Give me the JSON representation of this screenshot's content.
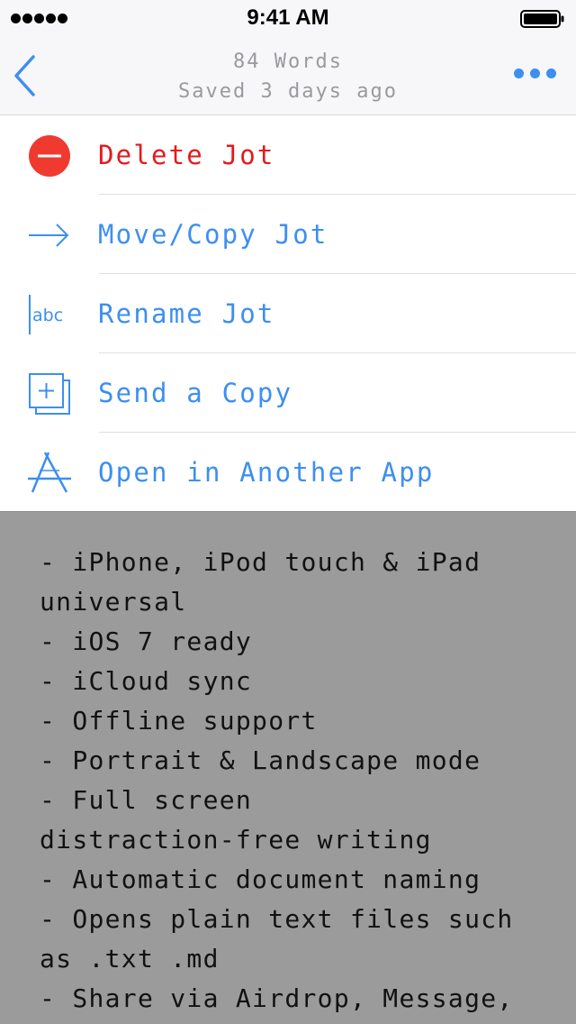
{
  "status_bar": {
    "time": "9:41 AM"
  },
  "nav": {
    "word_count": "84 Words",
    "saved": "Saved 3 days ago"
  },
  "menu": {
    "items": [
      {
        "label": "Delete Jot",
        "icon": "delete-icon"
      },
      {
        "label": "Move/Copy Jot",
        "icon": "arrow-right-icon"
      },
      {
        "label": "Rename Jot",
        "icon": "rename-icon"
      },
      {
        "label": "Send a Copy",
        "icon": "copy-icon"
      },
      {
        "label": "Open in Another App",
        "icon": "app-store-icon"
      }
    ],
    "rename_icon_text": "abc"
  },
  "document": {
    "lines": [
      "- iPhone, iPod touch & iPad",
      "universal",
      "- iOS 7 ready",
      "- iCloud sync",
      "- Offline support",
      "- Portrait & Landscape mode",
      "- Full screen",
      "distraction-free writing",
      "- Automatic document naming",
      "- Opens plain text files such",
      "as .txt .md",
      "- Share via Airdrop, Message,"
    ]
  },
  "colors": {
    "accent": "#3d8ff0",
    "danger": "#e5191d",
    "dim_overlay": "#9b9b9b",
    "bar_background": "#f7f7f9"
  }
}
